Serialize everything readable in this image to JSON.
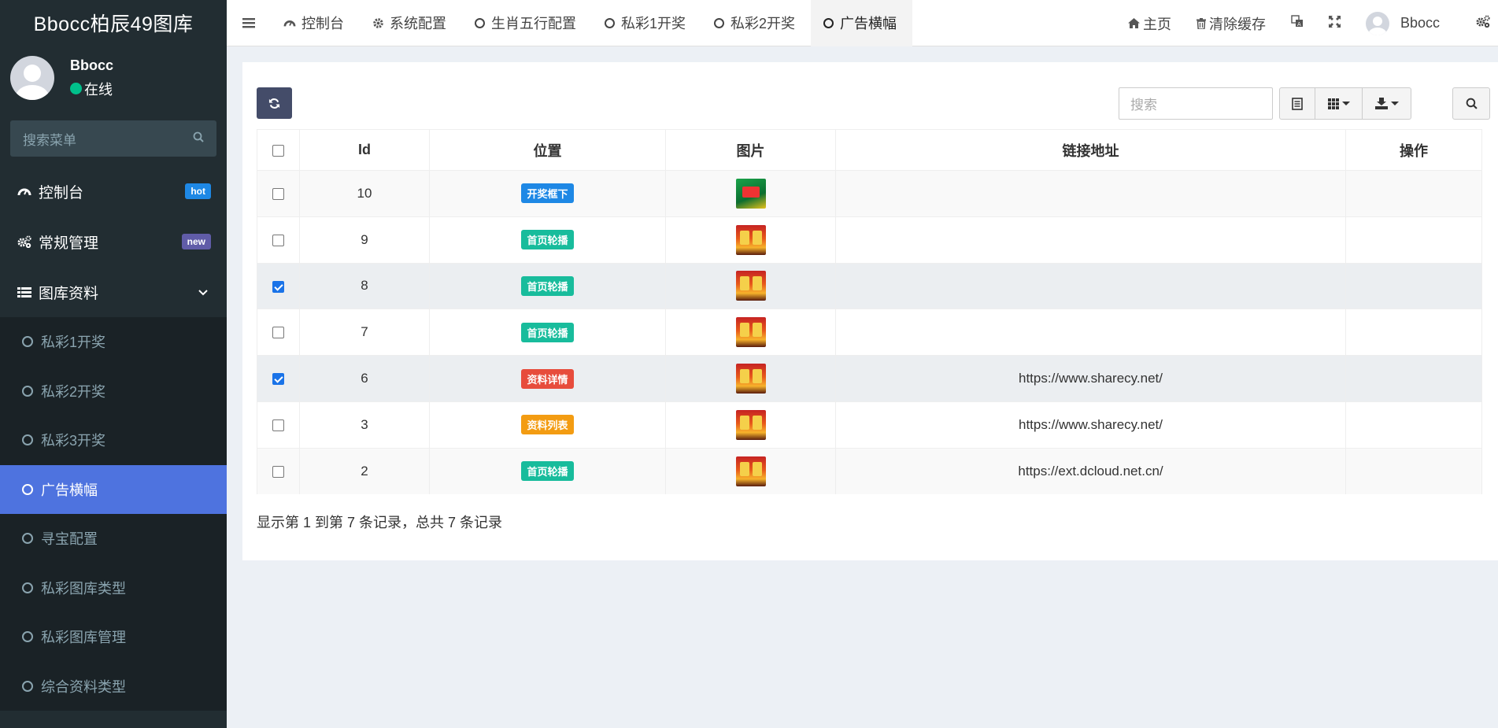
{
  "app": {
    "title": "Bbocc柏辰49图库"
  },
  "user": {
    "name": "Bbocc",
    "status": "在线"
  },
  "sidebar": {
    "search_placeholder": "搜索菜单",
    "items": [
      {
        "label": "控制台",
        "badge": "hot",
        "badge_color": "#1e88e5",
        "icon": "dashboard-icon"
      },
      {
        "label": "常规管理",
        "badge": "new",
        "badge_color": "#605ca8",
        "icon": "cogs-icon"
      },
      {
        "label": "图库资料",
        "icon": "list-icon",
        "expanded": true
      }
    ],
    "sub_items": [
      {
        "label": "私彩1开奖"
      },
      {
        "label": "私彩2开奖"
      },
      {
        "label": "私彩3开奖"
      },
      {
        "label": "广告横幅",
        "active": true
      },
      {
        "label": "寻宝配置"
      },
      {
        "label": "私彩图库类型"
      },
      {
        "label": "私彩图库管理"
      },
      {
        "label": "综合资料类型"
      }
    ]
  },
  "topnav": {
    "tabs": [
      {
        "label": "控制台",
        "icon": "dashboard-icon"
      },
      {
        "label": "系统配置",
        "icon": "gear-icon"
      },
      {
        "label": "生肖五行配置",
        "icon": "circle-icon"
      },
      {
        "label": "私彩1开奖",
        "icon": "circle-icon"
      },
      {
        "label": "私彩2开奖",
        "icon": "circle-icon"
      },
      {
        "label": "广告横幅",
        "icon": "circle-icon",
        "active": true
      }
    ],
    "right": {
      "home": "主页",
      "clear_cache": "清除缓存",
      "user": "Bbocc"
    }
  },
  "toolbar": {
    "search_placeholder": "搜索"
  },
  "table": {
    "columns": [
      "Id",
      "位置",
      "图片",
      "链接地址",
      "操作"
    ],
    "rows": [
      {
        "id": "10",
        "position": "开奖框下",
        "position_color": "#1e88e5",
        "image": "green",
        "url": "",
        "checked": false
      },
      {
        "id": "9",
        "position": "首页轮播",
        "position_color": "#18bc9c",
        "image": "red",
        "url": "",
        "checked": false
      },
      {
        "id": "8",
        "position": "首页轮播",
        "position_color": "#18bc9c",
        "image": "red",
        "url": "",
        "checked": true
      },
      {
        "id": "7",
        "position": "首页轮播",
        "position_color": "#18bc9c",
        "image": "red",
        "url": "",
        "checked": false
      },
      {
        "id": "6",
        "position": "资料详情",
        "position_color": "#e74c3c",
        "image": "red",
        "url": "https://www.sharecy.net/",
        "checked": true
      },
      {
        "id": "3",
        "position": "资料列表",
        "position_color": "#f39c12",
        "image": "red",
        "url": "https://www.sharecy.net/",
        "checked": false
      },
      {
        "id": "2",
        "position": "首页轮播",
        "position_color": "#18bc9c",
        "image": "red",
        "url": "https://ext.dcloud.net.cn/",
        "checked": false
      }
    ]
  },
  "pager": {
    "summary": "显示第 1 到第 7 条记录，总共 7 条记录"
  },
  "colors": {
    "sidebar_bg": "#222d32",
    "active_item": "#4e73df",
    "refresh_btn": "#444c69"
  }
}
